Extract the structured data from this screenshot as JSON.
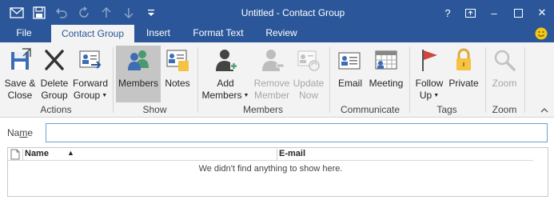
{
  "window": {
    "title": "Untitled  -  Contact Group",
    "help": "?",
    "minimize": "–",
    "close": "✕"
  },
  "quick_access": {
    "icons": [
      "outlook-icon",
      "save-icon",
      "undo-icon",
      "redo-icon",
      "up-icon",
      "down-icon",
      "customize-icon"
    ]
  },
  "tabs": [
    {
      "label": "File",
      "active": false
    },
    {
      "label": "Contact Group",
      "active": true
    },
    {
      "label": "Insert",
      "active": false
    },
    {
      "label": "Format Text",
      "active": false
    },
    {
      "label": "Review",
      "active": false
    }
  ],
  "ribbon": {
    "groups": [
      {
        "label": "Actions"
      },
      {
        "label": "Show"
      },
      {
        "label": "Members"
      },
      {
        "label": "Communicate"
      },
      {
        "label": "Tags"
      },
      {
        "label": "Zoom"
      }
    ],
    "buttons": {
      "save_close": {
        "line1": "Save &",
        "line2": "Close"
      },
      "delete_group": {
        "line1": "Delete",
        "line2": "Group"
      },
      "forward_group": {
        "line1": "Forward",
        "line2": "Group"
      },
      "members": {
        "line1": "Members"
      },
      "notes": {
        "line1": "Notes"
      },
      "add_members": {
        "line1": "Add",
        "line2": "Members"
      },
      "remove_member": {
        "line1": "Remove",
        "line2": "Member"
      },
      "update_now": {
        "line1": "Update",
        "line2": "Now"
      },
      "email": {
        "line1": "Email"
      },
      "meeting": {
        "line1": "Meeting"
      },
      "follow_up": {
        "line1": "Follow",
        "line2": "Up"
      },
      "private": {
        "line1": "Private"
      },
      "zoom": {
        "line1": "Zoom"
      }
    }
  },
  "form": {
    "name_label_prefix": "Na",
    "name_label_underlined": "m",
    "name_label_suffix": "e",
    "name_value": ""
  },
  "members_list": {
    "columns": [
      "Name",
      "E-mail"
    ],
    "sort_indicator": "▲",
    "empty_message": "We didn't find anything to show here."
  },
  "colors": {
    "accent": "#2b579a",
    "ribbon_bg": "#f3f3f3",
    "selected_btn": "#c5c5c5"
  }
}
